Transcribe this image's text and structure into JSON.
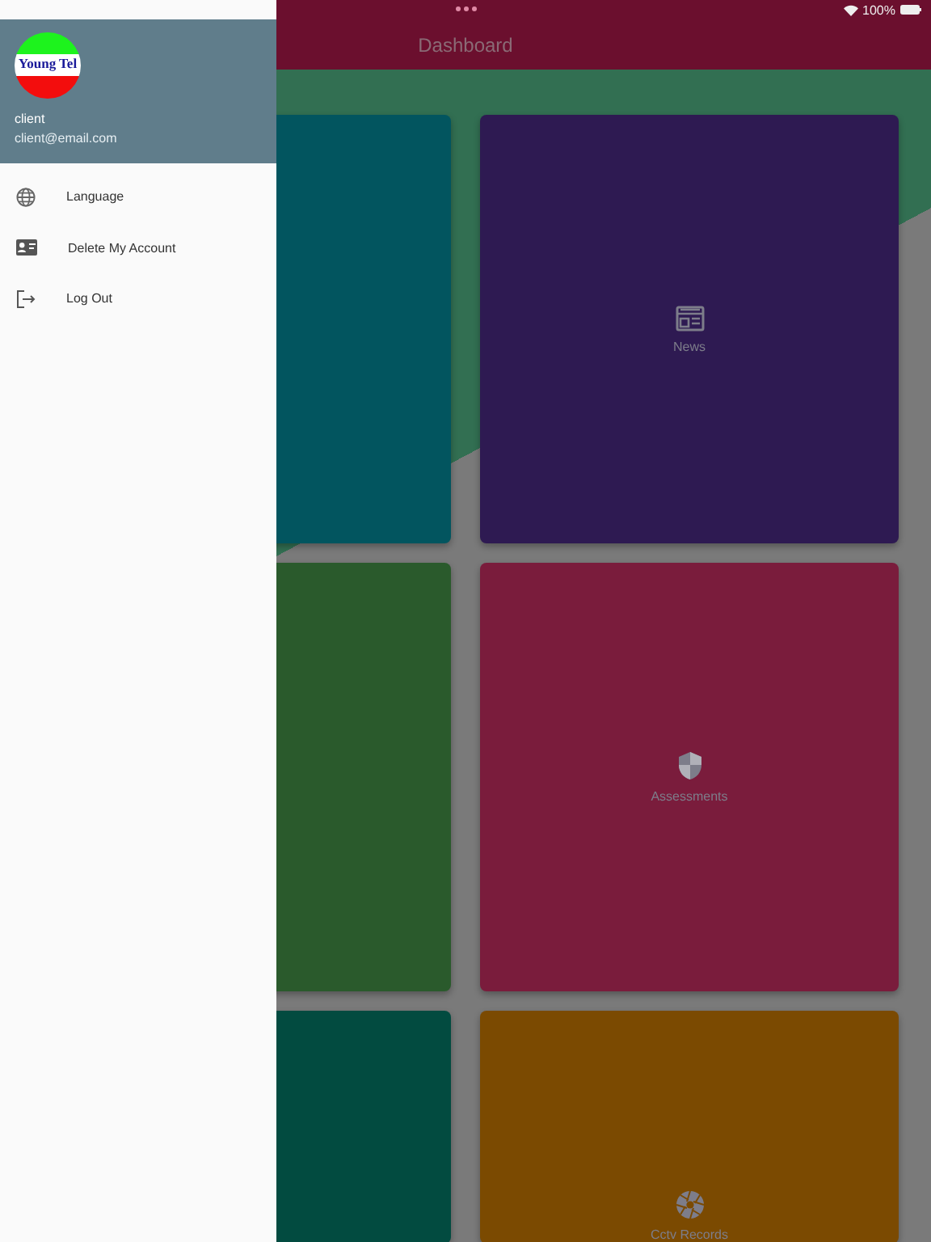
{
  "status_bar": {
    "battery": "100%"
  },
  "app_bar": {
    "title": "Dashboard"
  },
  "tiles": [
    {
      "color": "#02555f",
      "kind": "blank"
    },
    {
      "color": "#2e1a52",
      "kind": "news",
      "label": "News"
    },
    {
      "color": "#2a5a2c",
      "kind": "blank"
    },
    {
      "color": "#7a1c3c",
      "kind": "assessments",
      "label": "Assessments"
    },
    {
      "color": "#024b40",
      "kind": "blank"
    },
    {
      "color": "#7b4a01",
      "kind": "cctv",
      "label": "Cctv Records"
    }
  ],
  "drawer": {
    "logo": {
      "title": "Young Tel"
    },
    "user_name": "client",
    "user_email": "client@email.com",
    "items": [
      {
        "kind": "language",
        "label": "Language"
      },
      {
        "kind": "delete",
        "label": "Delete My Account"
      },
      {
        "kind": "logout",
        "label": "Log Out"
      }
    ]
  }
}
